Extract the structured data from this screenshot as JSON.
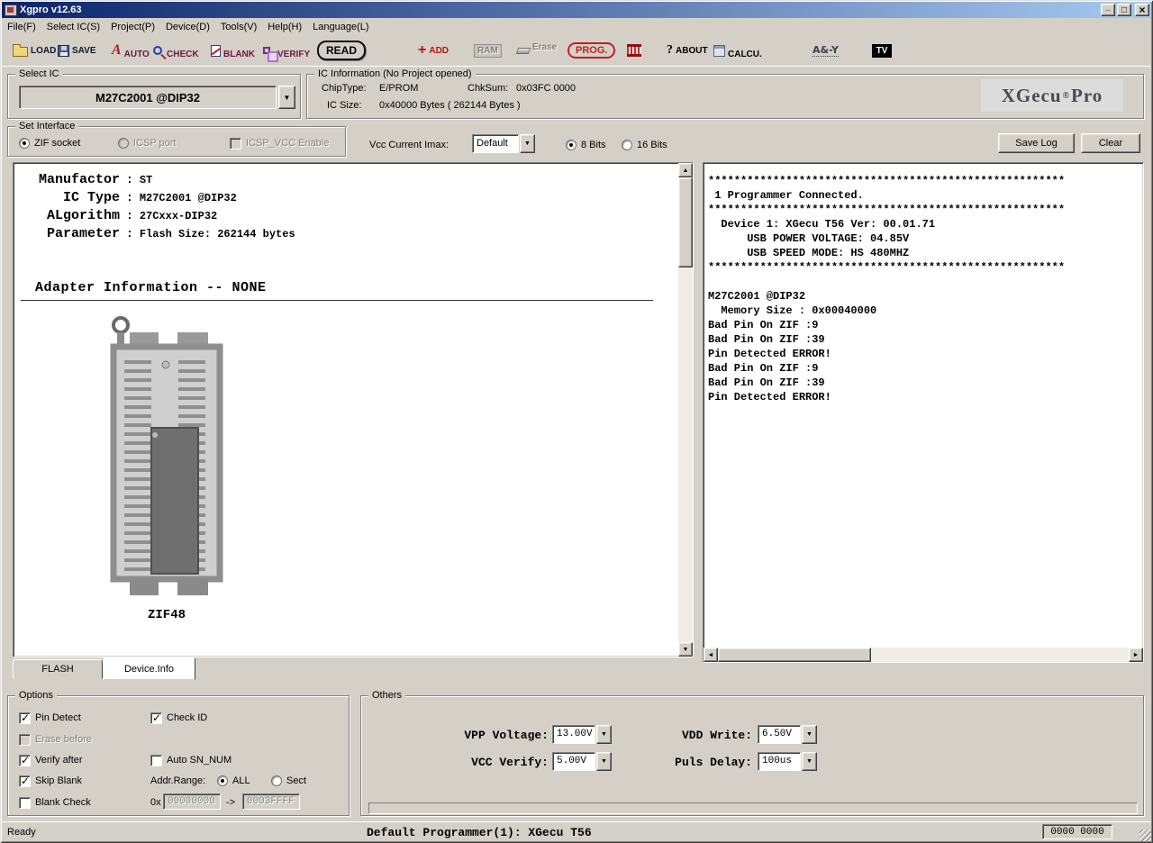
{
  "window": {
    "title": "Xgpro v12.63"
  },
  "menu": {
    "items": [
      "File(F)",
      "Select IC(S)",
      "Project(P)",
      "Device(D)",
      "Tools(V)",
      "Help(H)",
      "Language(L)"
    ]
  },
  "toolbar": {
    "items": [
      {
        "name": "load",
        "label": "LOAD"
      },
      {
        "name": "save",
        "label": "SAVE"
      },
      {
        "name": "auto",
        "glyph": "A",
        "label": "AUTO"
      },
      {
        "name": "check",
        "label": "CHECK"
      },
      {
        "name": "blank",
        "label": "BLANK"
      },
      {
        "name": "verify",
        "label": "VERIFY"
      },
      {
        "name": "read",
        "label": "READ"
      },
      {
        "name": "add",
        "glyph": "+",
        "label": "ADD"
      },
      {
        "name": "ram",
        "label": "RAM"
      },
      {
        "name": "erase",
        "label": "Erase"
      },
      {
        "name": "prog",
        "label": "PROG."
      },
      {
        "name": "chip",
        "label": ""
      },
      {
        "name": "about",
        "glyph": "?",
        "label": "ABOUT"
      },
      {
        "name": "calcu",
        "label": "CALCU."
      },
      {
        "name": "ay",
        "label": "A&-Y"
      },
      {
        "name": "tv",
        "label": "TV"
      }
    ]
  },
  "select_ic": {
    "label": "Select IC",
    "value": "M27C2001 @DIP32"
  },
  "ic_info": {
    "label": "IC Information (No Project opened)",
    "chip_type_label": "ChipType:",
    "chip_type": "E/PROM",
    "chksum_label": "ChkSum:",
    "chksum": "0x03FC 0000",
    "size_label": "IC Size:",
    "size": "0x40000 Bytes ( 262144 Bytes )",
    "brand": "XGecu",
    "brand_reg": "®",
    "brand_suffix": "Pro"
  },
  "interface": {
    "label": "Set Interface",
    "zif_socket": "ZIF socket",
    "icsp_port": "ICSP port",
    "icsp_vcc": "ICSP_VCC Enable",
    "vcc_imax_label": "Vcc Current Imax:",
    "vcc_imax_value": "Default",
    "bits_8": "8 Bits",
    "bits_16": "16 Bits",
    "save_log": "Save Log",
    "clear": "Clear"
  },
  "device_info": {
    "sep": ":",
    "rows": [
      {
        "label": "Manufactor",
        "value": "ST"
      },
      {
        "label": "IC Type",
        "value": "M27C2001 @DIP32"
      },
      {
        "label": "ALgorithm",
        "value": "27Cxxx-DIP32"
      },
      {
        "label": "Parameter",
        "value": "Flash Size: 262144 bytes"
      }
    ],
    "adapter_header": "Adapter Information -- NONE",
    "socket_label": "ZIF48"
  },
  "tabs": {
    "flash": "FLASH",
    "device": "Device.Info"
  },
  "log": {
    "lines": [
      "*******************************************************",
      " 1 Programmer Connected.",
      "*******************************************************",
      "  Device 1: XGecu T56 Ver: 00.01.71",
      "      USB POWER VOLTAGE: 04.85V",
      "      USB SPEED MODE: HS 480MHZ",
      "*******************************************************",
      "",
      "M27C2001 @DIP32",
      "  Memory Size : 0x00040000",
      "Bad Pin On ZIF :9",
      "Bad Pin On ZIF :39",
      "Pin Detected ERROR!",
      "Bad Pin On ZIF :9",
      "Bad Pin On ZIF :39",
      "Pin Detected ERROR!"
    ]
  },
  "options": {
    "label": "Options",
    "pin_detect": "Pin Detect",
    "check_id": "Check ID",
    "erase_before": "Erase before",
    "verify_after": "Verify after",
    "auto_sn": "Auto SN_NUM",
    "skip_blank": "Skip Blank",
    "addr_range_label": "Addr.Range:",
    "all": "ALL",
    "sect": "Sect",
    "blank_check": "Blank Check",
    "hex_prefix": "0x",
    "addr_from": "00000000",
    "arrow": "->",
    "addr_to": "0003FFFF"
  },
  "others": {
    "label": "Others",
    "vpp_label": "VPP Voltage:",
    "vpp": "13.00V",
    "vdd_label": "VDD Write:",
    "vdd": "6.50V",
    "vcc_label": "VCC Verify:",
    "vcc": "5.00V",
    "puls_label": "Puls Delay:",
    "puls": "100us"
  },
  "statusbar": {
    "ready": "Ready",
    "programmer": "Default Programmer(1): XGecu T56",
    "counter": "0000 0000"
  },
  "states": {
    "zif_socket": true,
    "icsp_port": false,
    "icsp_vcc": false,
    "bits8": true,
    "bits16": false,
    "pin_detect": true,
    "check_id": true,
    "erase_before": false,
    "verify_after": true,
    "auto_sn": false,
    "skip_blank": true,
    "blank_check": false,
    "addr_all": true,
    "addr_sect": false
  }
}
